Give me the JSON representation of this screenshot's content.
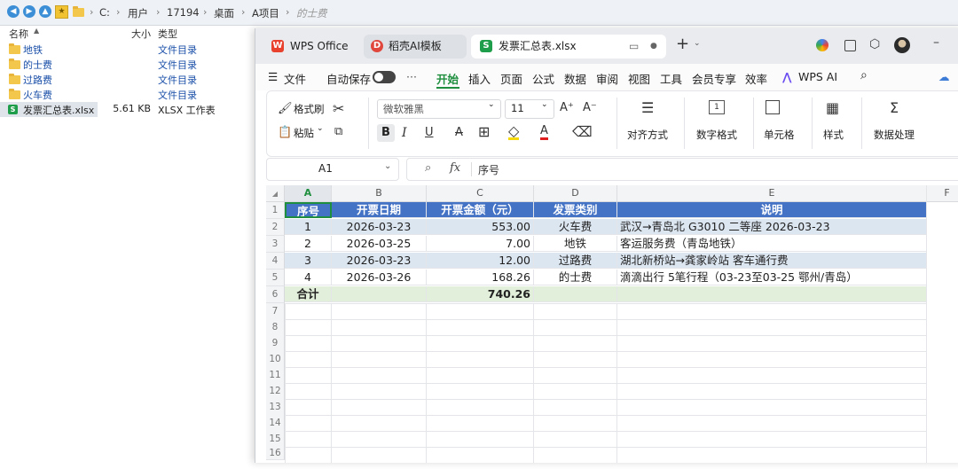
{
  "explorer": {
    "breadcrumbs": [
      "C:",
      "用户",
      "17194",
      "桌面",
      "A项目",
      "的士费"
    ],
    "columns": {
      "name": "名称",
      "size": "大小",
      "type": "类型"
    },
    "items": [
      {
        "name": "地铁",
        "size": "",
        "type": "文件目录",
        "kind": "folder"
      },
      {
        "name": "的士费",
        "size": "",
        "type": "文件目录",
        "kind": "folder"
      },
      {
        "name": "过路费",
        "size": "",
        "type": "文件目录",
        "kind": "folder"
      },
      {
        "name": "火车费",
        "size": "",
        "type": "文件目录",
        "kind": "folder"
      },
      {
        "name": "发票汇总表.xlsx",
        "size": "5.61 KB",
        "type": "XLSX 工作表",
        "kind": "xlsx"
      }
    ]
  },
  "wps": {
    "tabs": [
      {
        "label": "WPS Office",
        "icon": "W"
      },
      {
        "label": "稻壳AI模板",
        "icon": "D"
      },
      {
        "label": "发票汇总表.xlsx",
        "icon": "S"
      }
    ],
    "menu": {
      "file": "文件",
      "autosave": "自动保存",
      "items": [
        "开始",
        "插入",
        "页面",
        "公式",
        "数据",
        "审阅",
        "视图",
        "工具",
        "会员专享",
        "效率"
      ],
      "wps_ai": "WPS AI"
    },
    "ribbon": {
      "format_painter": "格式刷",
      "paste": "粘贴",
      "font_name": "微软雅黑",
      "font_size": "11",
      "align": "对齐方式",
      "number_format": "数字格式",
      "cells": "单元格",
      "styles": "样式",
      "data_processing": "数据处理"
    },
    "formula_bar": {
      "cell_ref": "A1",
      "fx": "fx",
      "content": "序号"
    },
    "sheet": {
      "col_letters": [
        "A",
        "B",
        "C",
        "D",
        "E",
        "F"
      ],
      "row_numbers": [
        "1",
        "2",
        "3",
        "4",
        "5",
        "6",
        "7",
        "8",
        "9",
        "10",
        "11",
        "12",
        "13",
        "14",
        "15",
        "16"
      ],
      "header": [
        "序号",
        "开票日期",
        "开票金额（元）",
        "发票类别",
        "说明"
      ],
      "rows": [
        [
          "1",
          "2026-03-23",
          "553.00",
          "火车费",
          "武汉→青岛北 G3010 二等座 2026-03-23"
        ],
        [
          "2",
          "2026-03-25",
          "7.00",
          "地铁",
          "客运服务费（青岛地铁）"
        ],
        [
          "3",
          "2026-03-23",
          "12.00",
          "过路费",
          "湖北新桥站→龚家岭站 客车通行费"
        ],
        [
          "4",
          "2026-03-26",
          "168.26",
          "的士费",
          "滴滴出行 5笔行程（03-23至03-25 鄂州/青岛）"
        ]
      ],
      "total": {
        "label": "合计",
        "amount": "740.26"
      }
    }
  }
}
